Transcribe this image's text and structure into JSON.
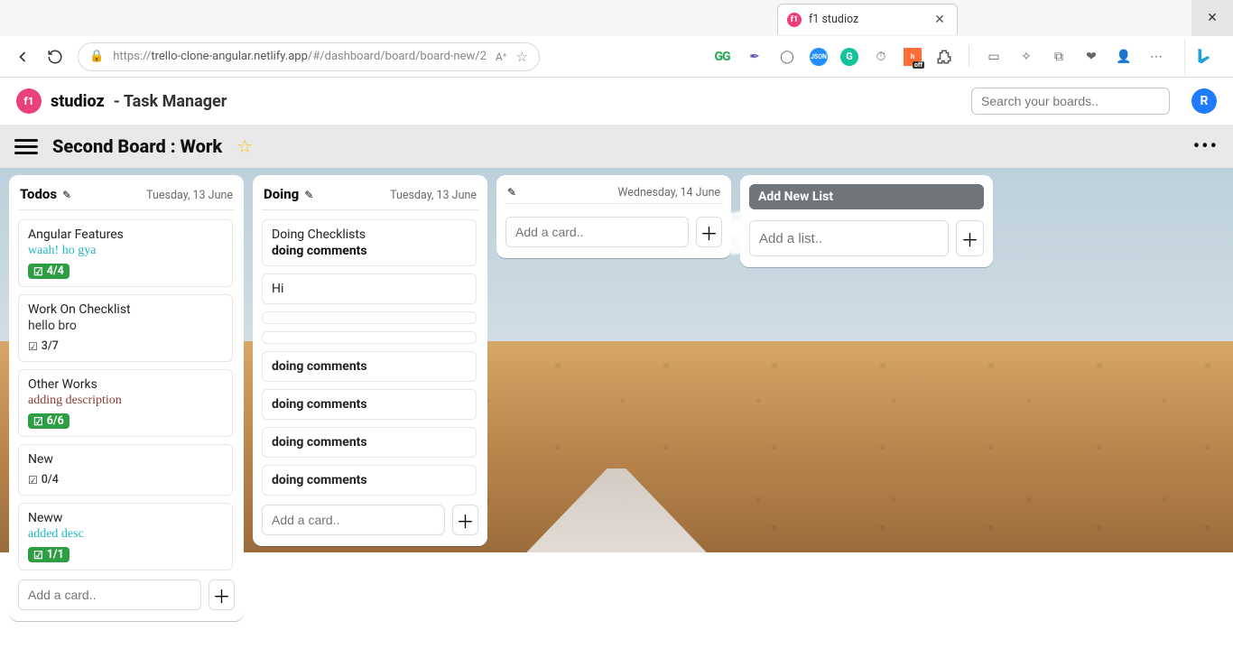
{
  "browser": {
    "tab_title": "f1 studioz",
    "url_before": "https://",
    "url_host": "trello-clone-angular.netlify.app",
    "url_path": "/#/dashboard/board/board-new/2"
  },
  "app": {
    "logo_text": "f1",
    "brand": "studioz",
    "brand_sub": " - Task Manager",
    "search_placeholder": "Search your boards..",
    "user_initial": "R"
  },
  "board": {
    "title": "Second Board : Work"
  },
  "lists": {
    "todos": {
      "title": "Todos",
      "date": "Tuesday, 13 June",
      "cards": [
        {
          "title": "Angular Features",
          "desc": "waah! ho gya",
          "desc_class": "teal",
          "badge": "4/4",
          "badge_style": "green"
        },
        {
          "title": "Work On Checklist",
          "desc": "hello bro",
          "desc_class": "plain",
          "badge": "3/7",
          "badge_style": "plain"
        },
        {
          "title": "Other Works",
          "desc": "adding description",
          "desc_class": "brown",
          "badge": "6/6",
          "badge_style": "green"
        },
        {
          "title": "New",
          "desc": "",
          "desc_class": "",
          "badge": "0/4",
          "badge_style": "plain"
        },
        {
          "title": "Neww",
          "desc": "added desc",
          "desc_class": "teal",
          "badge": "1/1",
          "badge_style": "green"
        }
      ],
      "add_placeholder": "Add a card.."
    },
    "doing": {
      "title": "Doing",
      "date": "Tuesday, 13 June",
      "cards_top": {
        "title": "Doing Checklists",
        "desc": "doing comments",
        "desc_class": "bold"
      },
      "hi": "Hi",
      "repeats": [
        "doing comments",
        "doing comments",
        "doing comments",
        "doing comments"
      ],
      "add_placeholder": "Add a card.."
    },
    "empty": {
      "date": "Wednesday, 14 June",
      "add_placeholder": "Add a card.."
    },
    "new_list": {
      "pill": "Add New List",
      "placeholder": "Add a list.."
    }
  }
}
